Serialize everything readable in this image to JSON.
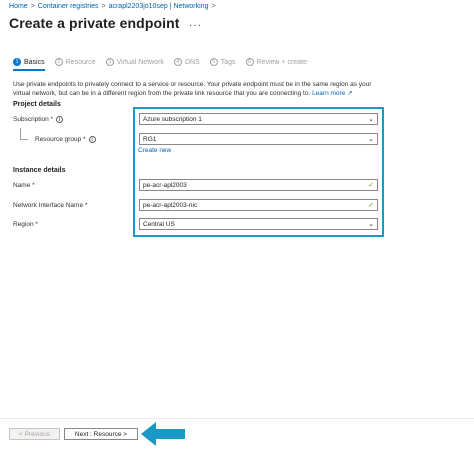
{
  "breadcrumb": {
    "items": [
      "Home",
      "Container registries",
      "acrapl2203jo10sep | Networking"
    ],
    "separator": ">"
  },
  "header": {
    "title": "Create a private endpoint",
    "more_label": "..."
  },
  "tabs": [
    {
      "num": "1",
      "label": "Basics",
      "active": true
    },
    {
      "num": "2",
      "label": "Resource",
      "active": false
    },
    {
      "num": "3",
      "label": "Virtual Network",
      "active": false
    },
    {
      "num": "4",
      "label": "DNS",
      "active": false
    },
    {
      "num": "5",
      "label": "Tags",
      "active": false
    },
    {
      "num": "6",
      "label": "Review + create",
      "active": false
    }
  ],
  "intro": {
    "text": "Use private endpoints to privately connect to a service or resource. Your private endpoint must be in the same region as your virtual network, but can be in a different region from the private link resource that you are connecting to.",
    "learn_more": "Learn more"
  },
  "project_details": {
    "heading": "Project details",
    "subscription_label": "Subscription *",
    "subscription_value": "Azure subscription 1",
    "resource_group_label": "Resource group *",
    "resource_group_value": "RG1",
    "create_new": "Create new"
  },
  "instance_details": {
    "heading": "Instance details",
    "name_label": "Name *",
    "name_value": "pe-acr-apl2003",
    "nic_label": "Network Interface Name *",
    "nic_value": "pe-acr-apl2003-nic",
    "region_label": "Region *",
    "region_value": "Central US"
  },
  "footer": {
    "previous_label": "< Previous",
    "next_label": "Next : Resource >"
  },
  "colors": {
    "accent": "#0078d4",
    "highlight": "#1a99c7",
    "arrow": "#1a99c7",
    "valid": "#57a300"
  }
}
